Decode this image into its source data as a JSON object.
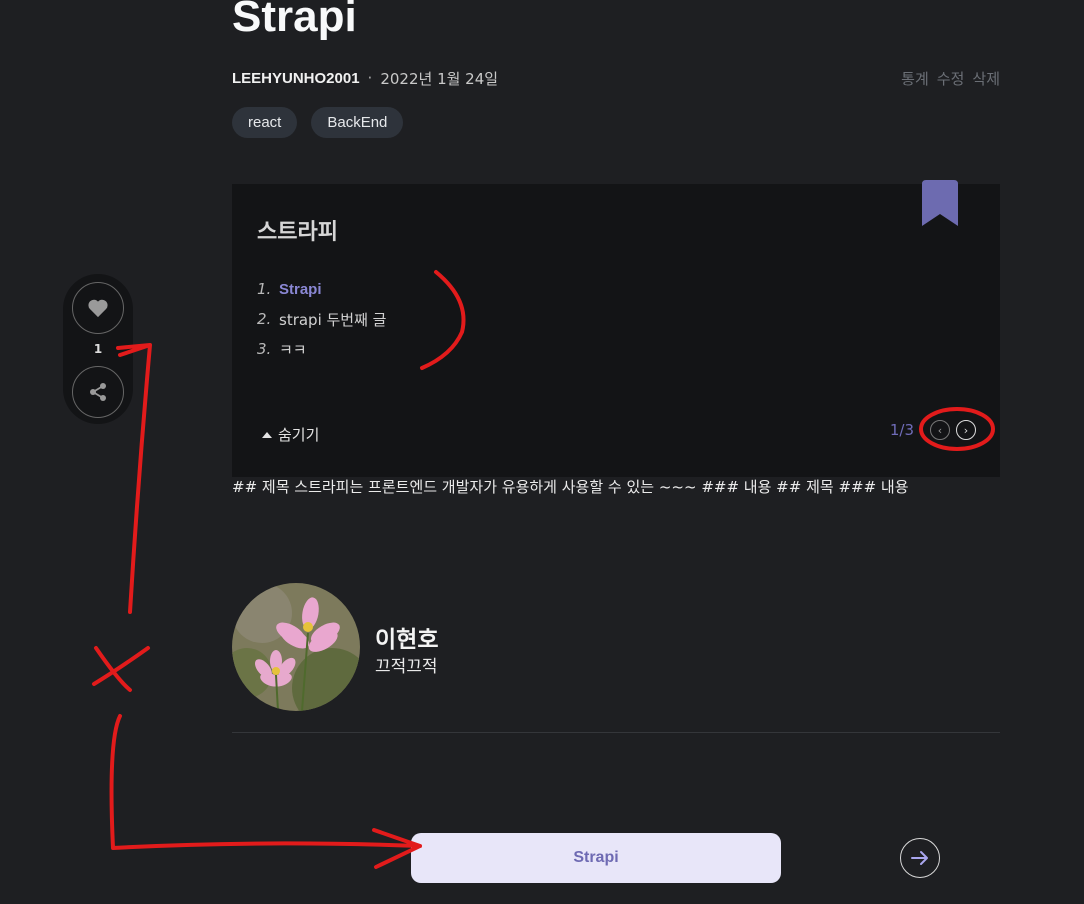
{
  "post": {
    "title": "Strapi",
    "author": "LEEHYUNHO2001",
    "separator": "·",
    "date": "2022년 1월 24일",
    "actions": [
      "통계",
      "수정",
      "삭제"
    ],
    "tags": [
      "react",
      "BackEnd"
    ]
  },
  "series": {
    "title": "스트라피",
    "items": [
      {
        "num": "1.",
        "label": "Strapi",
        "active": true
      },
      {
        "num": "2.",
        "label": "strapi 두번째 글",
        "active": false
      },
      {
        "num": "3.",
        "label": "ㅋㅋ",
        "active": false
      }
    ],
    "hide_label": "숨기기",
    "page": "1/3",
    "prev_icon": "chevron-left-icon",
    "next_icon": "chevron-right-icon"
  },
  "content": {
    "body": "## 제목 스트라피는 프론트엔드 개발자가 유용하게 사용할 수 있는 ~~~ ### 내용 ## 제목 ### 내용"
  },
  "profile": {
    "name": "이현호",
    "bio": "끄적끄적"
  },
  "footer": {
    "next_post": "Strapi"
  },
  "side": {
    "like_count": "1",
    "like_icon": "heart-icon",
    "share_icon": "share-icon"
  },
  "colors": {
    "background": "#1e1f22",
    "accent": "#6f6cb8",
    "annotation": "#e21b1b"
  }
}
